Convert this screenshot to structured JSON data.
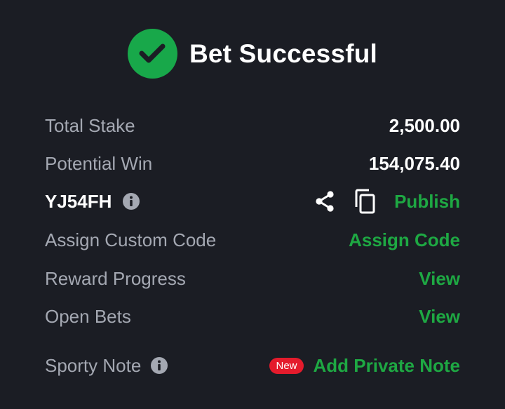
{
  "header": {
    "title": "Bet Successful"
  },
  "summary": {
    "total_stake_label": "Total Stake",
    "total_stake_value": "2,500.00",
    "potential_win_label": "Potential Win",
    "potential_win_value": "154,075.40"
  },
  "booking": {
    "code": "YJ54FH",
    "publish_label": "Publish"
  },
  "custom_code": {
    "label": "Assign Custom Code",
    "action": "Assign Code"
  },
  "reward_progress": {
    "label": "Reward Progress",
    "action": "View"
  },
  "open_bets": {
    "label": "Open Bets",
    "action": "View"
  },
  "sporty_note": {
    "label": "Sporty Note",
    "badge": "New",
    "action": "Add Private Note"
  },
  "icons": [
    "check-icon",
    "info-icon",
    "share-icon",
    "copy-icon"
  ],
  "colors": {
    "background": "#1b1d24",
    "success": "#18a84a",
    "action_green": "#1ea843",
    "label_gray": "#a4a8b2",
    "badge_red": "#e41b2c"
  }
}
